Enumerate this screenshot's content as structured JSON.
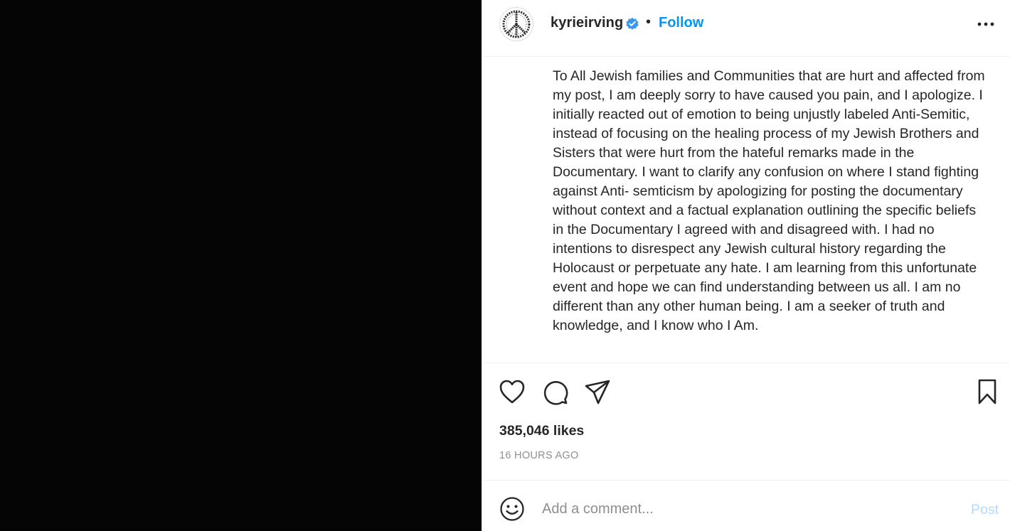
{
  "media": {
    "background": "#050505"
  },
  "header": {
    "username": "kyrieirving",
    "verified": true,
    "separator": "•",
    "follow_label": "Follow",
    "more_icon": "more-horizontal-icon",
    "avatar_icon": "peace-sign-icon"
  },
  "post": {
    "caption": "To All Jewish families and Communities that are hurt and affected from my post, I am deeply sorry to have caused you pain, and I apologize. I initially reacted out of emotion to being unjustly labeled Anti-Semitic, instead of focusing on the healing process of my Jewish Brothers and Sisters that were hurt from the hateful remarks made in the Documentary. I want to clarify any confusion on where I stand fighting against Anti- semticism by apologizing for posting the documentary without context and a factual explanation outlining the specific beliefs in the Documentary I agreed with and disagreed with. I had no intentions to disrespect any Jewish cultural history regarding the Holocaust or perpetuate any hate. I am learning from this unfortunate event and hope we can find understanding between us all. I am no different than any other human being. I am a seeker of truth and knowledge, and I know who I Am."
  },
  "actions": {
    "icons": [
      "heart-icon",
      "comment-icon",
      "share-icon",
      "bookmark-icon"
    ],
    "likes_text": "385,046 likes",
    "timestamp": "16 HOURS AGO"
  },
  "comment": {
    "placeholder": "Add a comment...",
    "post_label": "Post",
    "emoji_icon": "emoji-icon"
  },
  "colors": {
    "accent": "#0095f6",
    "post_disabled": "#b3dbff",
    "muted": "#8e8e8e",
    "text": "#262626"
  }
}
